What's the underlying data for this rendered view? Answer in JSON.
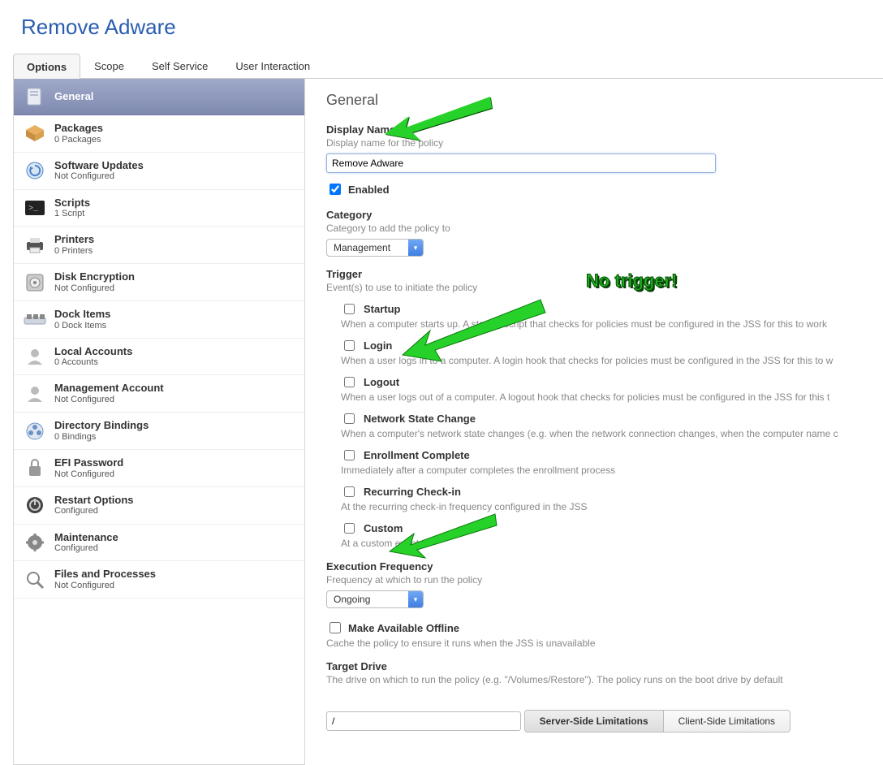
{
  "page_title": "Remove Adware",
  "tabs": [
    "Options",
    "Scope",
    "Self Service",
    "User Interaction"
  ],
  "active_tab": 0,
  "sidebar": [
    {
      "label": "General",
      "sub": "",
      "icon": "page-icon"
    },
    {
      "label": "Packages",
      "sub": "0 Packages",
      "icon": "box-icon"
    },
    {
      "label": "Software Updates",
      "sub": "Not Configured",
      "icon": "update-icon"
    },
    {
      "label": "Scripts",
      "sub": "1 Script",
      "icon": "terminal-icon"
    },
    {
      "label": "Printers",
      "sub": "0 Printers",
      "icon": "printer-icon"
    },
    {
      "label": "Disk Encryption",
      "sub": "Not Configured",
      "icon": "vault-icon"
    },
    {
      "label": "Dock Items",
      "sub": "0 Dock Items",
      "icon": "dock-icon"
    },
    {
      "label": "Local Accounts",
      "sub": "0 Accounts",
      "icon": "user-icon"
    },
    {
      "label": "Management Account",
      "sub": "Not Configured",
      "icon": "user-icon"
    },
    {
      "label": "Directory Bindings",
      "sub": "0 Bindings",
      "icon": "bind-icon"
    },
    {
      "label": "EFI Password",
      "sub": "Not Configured",
      "icon": "lock-icon"
    },
    {
      "label": "Restart Options",
      "sub": "Configured",
      "icon": "power-icon"
    },
    {
      "label": "Maintenance",
      "sub": "Configured",
      "icon": "gear-icon"
    },
    {
      "label": "Files and Processes",
      "sub": "Not Configured",
      "icon": "search-icon"
    }
  ],
  "main": {
    "section_title": "General",
    "display_name": {
      "label": "Display Name",
      "hint": "Display name for the policy",
      "value": "Remove Adware"
    },
    "enabled": {
      "label": "Enabled",
      "checked": true
    },
    "category": {
      "label": "Category",
      "hint": "Category to add the policy to",
      "value": "Management"
    },
    "trigger": {
      "label": "Trigger",
      "hint": "Event(s) to use to initiate the policy",
      "items": [
        {
          "label": "Startup",
          "desc": "When a computer starts up. A startup script that checks for policies must be configured in the JSS for this to work"
        },
        {
          "label": "Login",
          "desc": "When a user logs in to a computer. A login hook that checks for policies must be configured in the JSS for this to w"
        },
        {
          "label": "Logout",
          "desc": "When a user logs out of a computer. A logout hook that checks for policies must be configured in the JSS for this t"
        },
        {
          "label": "Network State Change",
          "desc": "When a computer's network state changes (e.g. when the network connection changes, when the computer name c"
        },
        {
          "label": "Enrollment Complete",
          "desc": "Immediately after a computer completes the enrollment process"
        },
        {
          "label": "Recurring Check-in",
          "desc": "At the recurring check-in frequency configured in the JSS"
        },
        {
          "label": "Custom",
          "desc": "At a custom event"
        }
      ]
    },
    "exec_freq": {
      "label": "Execution Frequency",
      "hint": "Frequency at which to run the policy",
      "value": "Ongoing"
    },
    "offline": {
      "label": "Make Available Offline",
      "hint": "Cache the policy to ensure it runs when the JSS is unavailable",
      "checked": false
    },
    "target_drive": {
      "label": "Target Drive",
      "hint": "The drive on which to run the policy (e.g. \"/Volumes/Restore\"). The policy runs on the boot drive by default",
      "value": "/"
    },
    "segments": [
      "Server-Side Limitations",
      "Client-Side Limitations"
    ],
    "active_segment": 0
  },
  "annotations": {
    "no_trigger": "No trigger!"
  }
}
